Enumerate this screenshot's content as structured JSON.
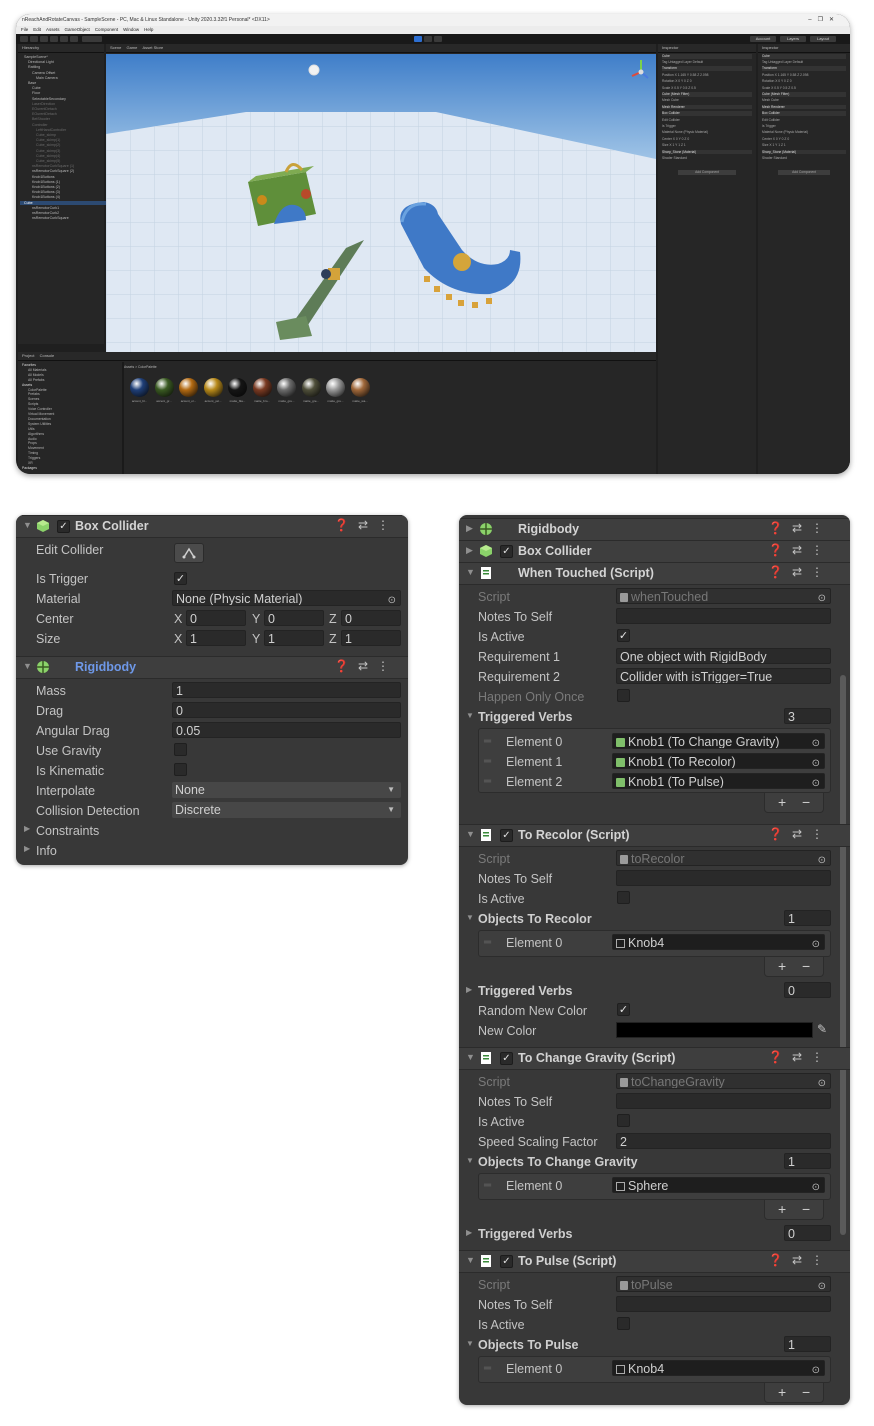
{
  "editor": {
    "title": "nReachAndRotateCanvas - SampleScene - PC, Mac & Linux Standalone - Unity 2020.3.32f1 Personal* <DX11>",
    "menu": [
      "File",
      "Edit",
      "Assets",
      "GameObject",
      "Component",
      "Window",
      "Help"
    ],
    "window_controls": [
      "–",
      "❐",
      "✕"
    ],
    "toolbar_right": [
      "Account",
      "Layers",
      "Layout"
    ],
    "hierarchy": {
      "tab": "Hierarchy",
      "items": [
        "SampleScene*",
        "Directional Light",
        "Rattling",
        "Camera Offset",
        "Main Camera",
        "Base",
        "Cube",
        "Floor",
        "SelectableSecondary",
        "LaserDirection",
        "EOurentDetach",
        "EOurentDetach",
        "BetShooter",
        "Controller",
        "LeftHandController",
        "Cube_skimp",
        "Cube_skimp(1)",
        "Cube_skimp(2)",
        "Cube_skimp(3)",
        "Cube_skimp(4)",
        "Cube_skimp(5)",
        "nsRemotorCurkSquare (1)",
        "nsRemotorCurkSquare (2)",
        "Knob1Buttons",
        "Knob1Buttons (1)",
        "Knob1Buttons (2)",
        "Knob1Buttons (3)",
        "Knob1Buttons (4)",
        "Cube",
        "nsRemotorCurk1",
        "nsRemotorCurk2",
        "nsRemotorCurkSquare"
      ]
    },
    "scene_tabs": [
      "Scene",
      "Game",
      "Asset Store"
    ],
    "scene_toolbar": [
      "Shaded",
      "2D",
      "Gizmos"
    ],
    "inspector_a": {
      "tab": "Inspector",
      "name": "Cube",
      "rows": [
        "Tag Untagged  Layer Default",
        "Transform",
        "Position  X 1.165  Y 0.58  Z 2.098",
        "Rotation  X 0  Y 0  Z 0",
        "Scale  X 0.5  Y 0.5  Z 0.5",
        "Cube (Mesh Filter)",
        "Mesh  Cube",
        "Mesh Renderer",
        "Box Collider",
        "Edit Collider",
        "Is Trigger",
        "Material  None (Physic Material)",
        "Center  X 0  Y 0  Z 0",
        "Size  X 1  Y 1  Z 1",
        "Sharp_Stone (Material)",
        "Shader  Standard"
      ],
      "add_component": "Add Component"
    },
    "inspector_b": {
      "tab": "Inspector",
      "name": "Cube",
      "rows": [
        "Tag Untagged  Layer Default",
        "Transform",
        "Position  X 1.165  Y 0.58  Z 2.098",
        "Rotation  X 0  Y 0  Z 0",
        "Scale  X 0.5  Y 0.5  Z 0.5",
        "Cube (Mesh Filter)",
        "Mesh  Cube",
        "Mesh Renderer",
        "Box Collider",
        "Edit Collider",
        "Is Trigger",
        "Material  None (Physic Material)",
        "Center  X 0  Y 0  Z 0",
        "Size  X 1  Y 1  Z 1",
        "Sharp_Stone (Material)",
        "Shader  Standard"
      ],
      "add_component": "Add Component"
    },
    "project": {
      "tabs": [
        "Project",
        "Console"
      ],
      "breadcrumb": "Assets > ColorPalette",
      "tree": [
        "Favorites",
        "All Materials",
        "All Models",
        "All Prefabs",
        "Assets",
        "ColorPalette",
        "Prefabs",
        "Scenes",
        "Scripts",
        "Voice Controller",
        "Virtual Movement",
        "Documentation",
        "System Utilities",
        "Utils",
        "Algorithms",
        "Audio",
        "Props",
        "Movement",
        "Timing",
        "Triggers",
        "XR",
        "Packages"
      ],
      "assets": [
        "accent_bl...",
        "accent_gr...",
        "accent_or...",
        "accent_yel...",
        "matte_bla...",
        "matte_bro...",
        "matte_gre...",
        "matte_gre...",
        "matte_gre...",
        "matte_wa..."
      ],
      "ball_colors": [
        "#1f3f78",
        "#3a5a22",
        "#b36a12",
        "#b88a1a",
        "#151515",
        "#7a3a22",
        "#6d6d6d",
        "#4f4f3a",
        "#9a9a9a",
        "#a0683a"
      ]
    }
  },
  "box_collider_panel": {
    "title": "Box Collider",
    "edit_collider": "Edit Collider",
    "is_trigger": "Is Trigger",
    "material_label": "Material",
    "material_value": "None (Physic Material)",
    "center_label": "Center",
    "center": {
      "x": "0",
      "y": "0",
      "z": "0"
    },
    "size_label": "Size",
    "size": {
      "x": "1",
      "y": "1",
      "z": "1"
    },
    "axis_labels": {
      "x": "X",
      "y": "Y",
      "z": "Z"
    }
  },
  "rigidbody_panel": {
    "title": "Rigidbody",
    "mass_label": "Mass",
    "mass": "1",
    "drag_label": "Drag",
    "drag": "0",
    "angular_drag_label": "Angular Drag",
    "angular_drag": "0.05",
    "use_gravity": "Use Gravity",
    "is_kinematic": "Is Kinematic",
    "interpolate_label": "Interpolate",
    "interpolate": "None",
    "collision_label": "Collision Detection",
    "collision": "Discrete",
    "constraints": "Constraints",
    "info": "Info"
  },
  "right_panel": {
    "rigidbody": "Rigidbody",
    "box_collider": "Box Collider",
    "when_touched": {
      "title": "When Touched (Script)",
      "script_label": "Script",
      "script": "whenTouched",
      "notes_label": "Notes To Self",
      "is_active_label": "Is Active",
      "req1_label": "Requirement 1",
      "req1": "One object with RigidBody",
      "req2_label": "Requirement 2",
      "req2": "Collider with isTrigger=True",
      "happen_once_label": "Happen Only Once",
      "verbs_label": "Triggered Verbs",
      "verbs_count": "3",
      "elements": [
        {
          "label": "Element 0",
          "value": "Knob1 (To Change Gravity)"
        },
        {
          "label": "Element 1",
          "value": "Knob1 (To Recolor)"
        },
        {
          "label": "Element 2",
          "value": "Knob1 (To Pulse)"
        }
      ]
    },
    "to_recolor": {
      "title": "To Recolor (Script)",
      "script_label": "Script",
      "script": "toRecolor",
      "notes_label": "Notes To Self",
      "is_active_label": "Is Active",
      "objects_label": "Objects To Recolor",
      "objects_count": "1",
      "element_label": "Element 0",
      "element_value": "Knob4",
      "verbs_label": "Triggered Verbs",
      "verbs_count": "0",
      "random_label": "Random New Color",
      "new_color_label": "New Color",
      "new_color": "#000000"
    },
    "to_change_gravity": {
      "title": "To Change Gravity (Script)",
      "script_label": "Script",
      "script": "toChangeGravity",
      "notes_label": "Notes To Self",
      "is_active_label": "Is Active",
      "speed_label": "Speed Scaling Factor",
      "speed": "2",
      "objects_label": "Objects To Change Gravity",
      "objects_count": "1",
      "element_label": "Element 0",
      "element_value": "Sphere",
      "verbs_label": "Triggered Verbs",
      "verbs_count": "0"
    },
    "to_pulse": {
      "title": "To Pulse (Script)",
      "script_label": "Script",
      "script": "toPulse",
      "notes_label": "Notes To Self",
      "is_active_label": "Is Active",
      "objects_label": "Objects To Pulse",
      "objects_count": "1",
      "element_label": "Element 0",
      "element_value": "Knob4"
    }
  },
  "symbols": {
    "check": "✓",
    "plus": "+",
    "minus": "−",
    "fold_open": "▼",
    "fold_closed": "▶",
    "header_icons": "❓⇄⋮",
    "dropdown": "▼",
    "target": "⊙",
    "grip": "═",
    "eyedropper": "✎"
  }
}
